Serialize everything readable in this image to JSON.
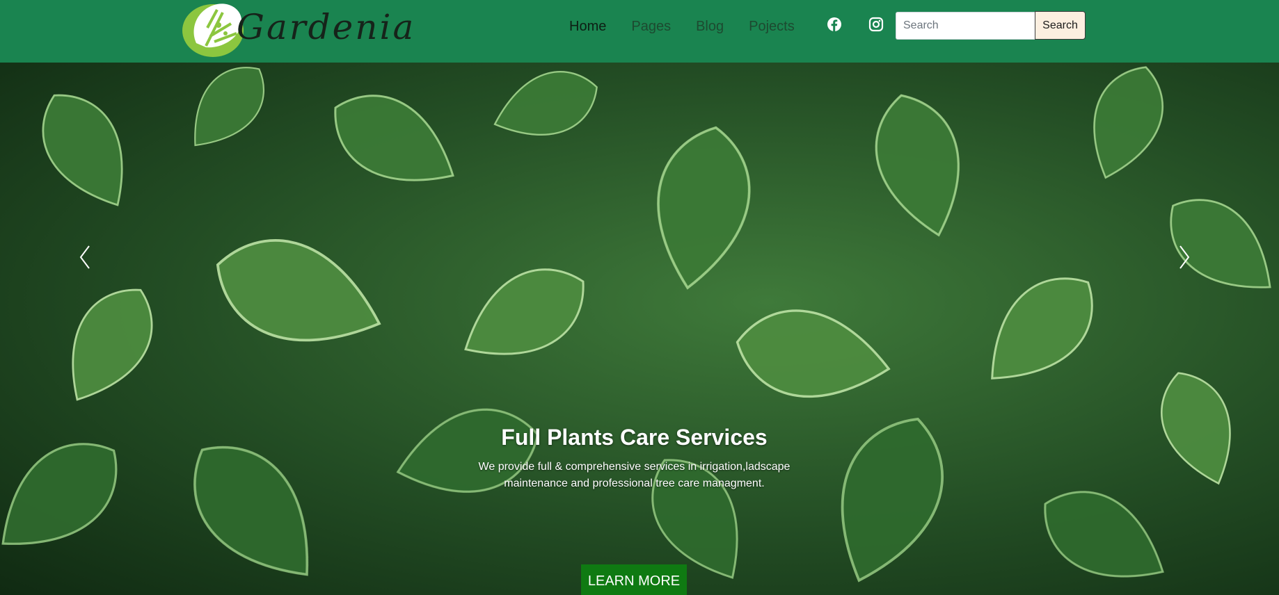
{
  "brand": {
    "name": "Gardenia",
    "logo_icon": "monstera-leaf-icon"
  },
  "nav": {
    "items": [
      {
        "label": "Home",
        "active": true
      },
      {
        "label": "Pages",
        "active": false
      },
      {
        "label": "Blog",
        "active": false
      },
      {
        "label": "Pojects",
        "active": false
      }
    ]
  },
  "social": [
    {
      "icon": "facebook-icon"
    },
    {
      "icon": "instagram-icon"
    }
  ],
  "search": {
    "placeholder": "Search",
    "value": "",
    "button_label": "Search"
  },
  "hero": {
    "title": "Full Plants Care Services",
    "text": "We provide full & comprehensive services in irrigation,ladscape maintenance and professional tree care managment.",
    "button_label": "LEARN MORE",
    "prev_icon": "chevron-left-icon",
    "next_icon": "chevron-right-icon"
  },
  "colors": {
    "navbar": "#1a8450",
    "cta": "#0f7a12",
    "search_button": "#fcefe0",
    "leaf_accent": "#8cc63f"
  }
}
